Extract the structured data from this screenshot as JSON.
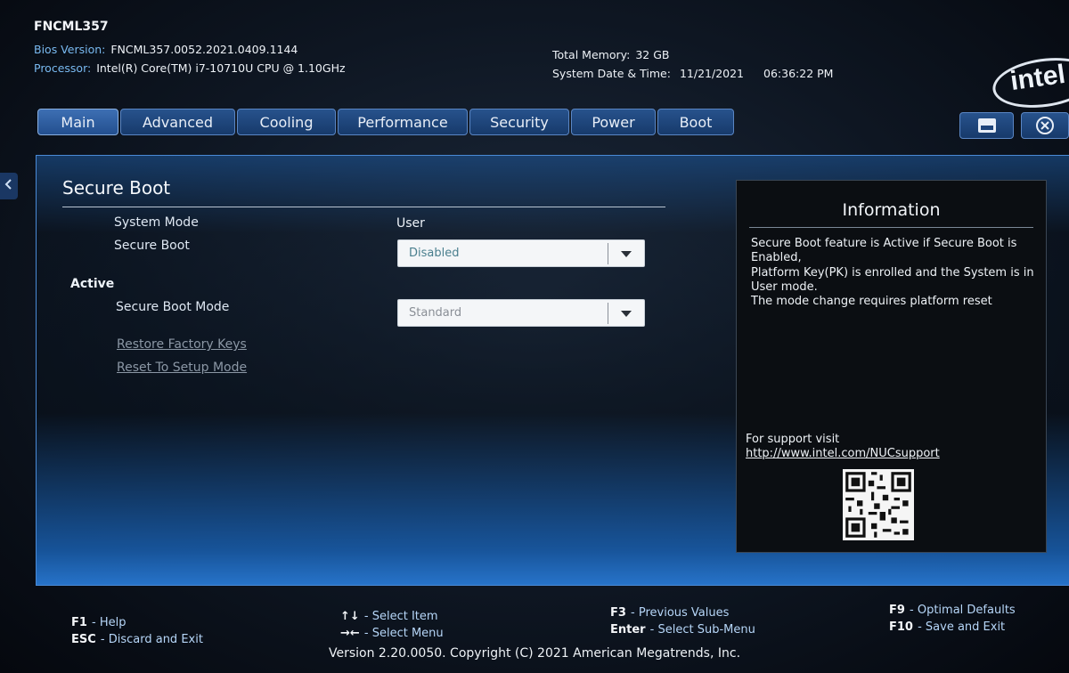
{
  "header": {
    "board": "FNCML357",
    "bios_key": "Bios Version:",
    "bios_val": "FNCML357.0052.2021.0409.1144",
    "proc_key": "Processor:",
    "proc_val": "Intel(R) Core(TM) i7-10710U CPU @ 1.10GHz",
    "mem_key": "Total Memory:",
    "mem_val": "32 GB",
    "dt_key": "System Date & Time:",
    "date": "11/21/2021",
    "time": "06:36:22 PM",
    "logo": "intel"
  },
  "tabs": [
    {
      "label": "Main"
    },
    {
      "label": "Advanced"
    },
    {
      "label": "Cooling"
    },
    {
      "label": "Performance"
    },
    {
      "label": "Security"
    },
    {
      "label": "Power"
    },
    {
      "label": "Boot"
    }
  ],
  "toolbar": {
    "save_icon": "save-icon",
    "close_icon": "close-icon"
  },
  "section": {
    "title": "Secure Boot",
    "system_mode_label": "System Mode",
    "system_mode_value": "User",
    "secure_boot_label": "Secure Boot",
    "secure_boot_value": "Disabled",
    "status_label": "Active",
    "secure_boot_mode_label": "Secure Boot Mode",
    "secure_boot_mode_value": "Standard",
    "restore_keys": "Restore Factory Keys",
    "reset_setup": "Reset To Setup Mode"
  },
  "info": {
    "title": "Information",
    "line1": "Secure Boot feature is Active if Secure Boot is",
    "line2": "Enabled,",
    "line3": "Platform Key(PK) is enrolled and the System is in",
    "line4": "User mode.",
    "line5": "The mode change requires platform reset",
    "support_text": "For support visit",
    "support_link": "http://www.intel.com/NUCsupport"
  },
  "footer": {
    "f1_key": "F1",
    "f1_desc": "- Help",
    "esc_key": "ESC",
    "esc_desc": "- Discard and Exit",
    "arrows_ud": "↑↓",
    "select_item": "- Select Item",
    "arrows_lr": "→←",
    "select_menu": "- Select Menu",
    "f3_key": "F3",
    "f3_desc": "- Previous Values",
    "enter_key": "Enter",
    "enter_desc": "- Select Sub-Menu",
    "f9_key": "F9",
    "f9_desc": "- Optimal Defaults",
    "f10_key": "F10",
    "f10_desc": "- Save and Exit",
    "copyright": "Version 2.20.0050. Copyright (C) 2021 American Megatrends, Inc."
  }
}
